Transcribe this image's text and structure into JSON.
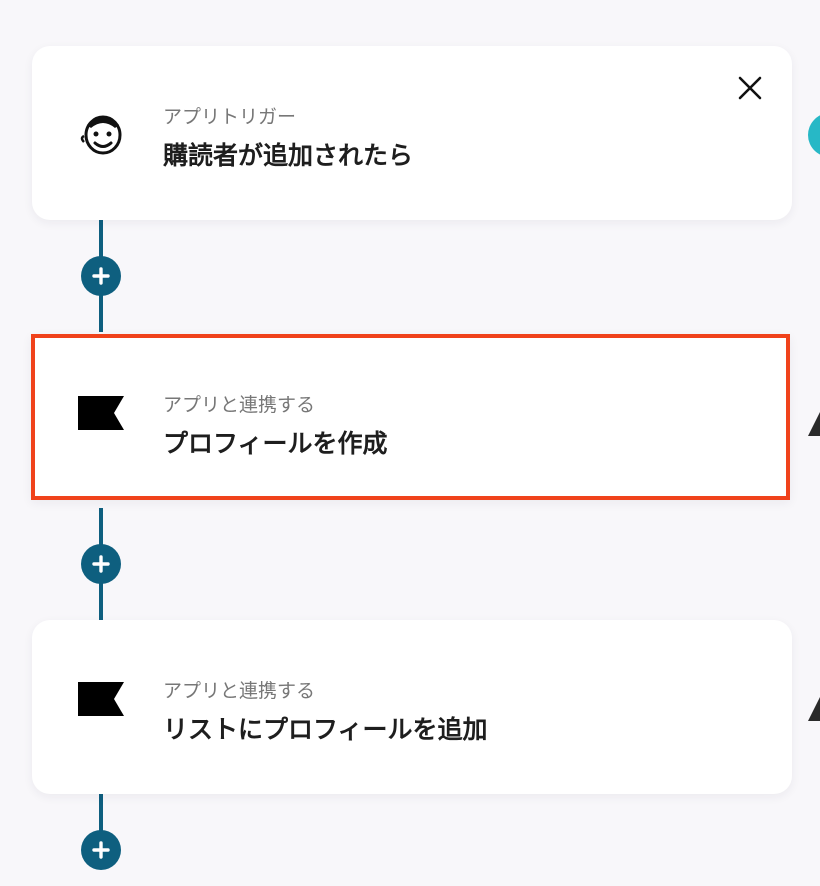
{
  "flow": {
    "steps": [
      {
        "subtitle": "アプリトリガー",
        "title": "購読者が追加されたら",
        "icon": "mailchimp-icon"
      },
      {
        "subtitle": "アプリと連携する",
        "title": "プロフィールを作成",
        "icon": "klaviyo-flag-icon",
        "selected": true
      },
      {
        "subtitle": "アプリと連携する",
        "title": "リストにプロフィールを追加",
        "icon": "klaviyo-flag-icon"
      }
    ],
    "add_icon": "plus-icon",
    "close_icon": "close-icon"
  },
  "colors": {
    "background": "#f8f7fa",
    "connector": "#0e5f7f",
    "selected_border": "#f0421b",
    "edge_accent": "#27b8c6"
  }
}
